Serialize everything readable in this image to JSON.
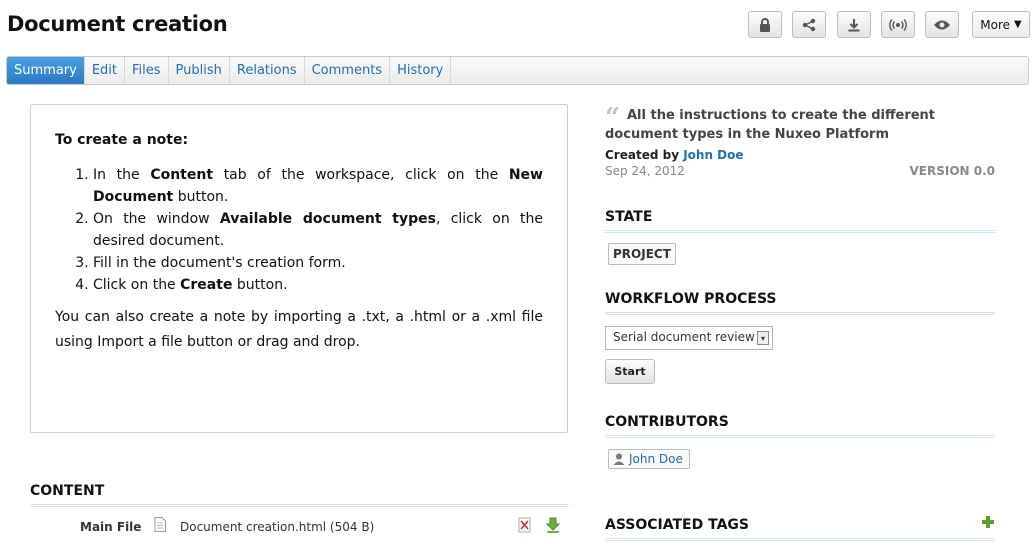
{
  "page": {
    "title": "Document creation"
  },
  "actions": {
    "buttons": [
      {
        "icon": "lock-icon",
        "label": ""
      },
      {
        "icon": "share-icon",
        "label": ""
      },
      {
        "icon": "download-icon",
        "label": ""
      },
      {
        "icon": "broadcast-icon",
        "label": ""
      },
      {
        "icon": "eye-icon",
        "label": ""
      }
    ],
    "more_label": "More",
    "more_arrow": "▼"
  },
  "tabs": [
    {
      "label": "Summary",
      "active": true
    },
    {
      "label": "Edit"
    },
    {
      "label": "Files"
    },
    {
      "label": "Publish"
    },
    {
      "label": "Relations"
    },
    {
      "label": "Comments"
    },
    {
      "label": "History"
    }
  ],
  "note": {
    "heading": "To create a note:",
    "steps": [
      {
        "parts": [
          "In the ",
          "*Content",
          " tab of the workspace, click on the ",
          "*New Document",
          " button."
        ]
      },
      {
        "parts": [
          "On the window ",
          "*Available document types",
          ", click on the desired document."
        ]
      },
      {
        "parts": [
          "Fill in the document's creation form."
        ]
      },
      {
        "parts": [
          "Click on the ",
          "*Create",
          " button."
        ]
      }
    ],
    "tail": "You can also create a note by importing a .txt, a .html or a .xml file using Import a file button or drag and drop."
  },
  "content": {
    "title": "CONTENT",
    "main_file_label": "Main File",
    "file_name": "Document creation.html (504 B)"
  },
  "summary": {
    "quote_mark": "“",
    "description": "All the instructions to create the different document types in the Nuxeo Platform",
    "created_by_label": "Created by",
    "author": "John Doe",
    "date": "Sep 24, 2012",
    "version": "VERSION 0.0"
  },
  "state": {
    "title": "STATE",
    "value": "PROJECT"
  },
  "workflow": {
    "title": "WORKFLOW PROCESS",
    "selected": "Serial document review",
    "start_label": "Start"
  },
  "contributors": {
    "title": "CONTRIBUTORS",
    "users": [
      "John Doe"
    ]
  },
  "tags": {
    "title": "ASSOCIATED TAGS"
  },
  "colors": {
    "link": "#1f6fb2",
    "tab_active": "#2a79c4",
    "add_green": "#5aa02c"
  }
}
